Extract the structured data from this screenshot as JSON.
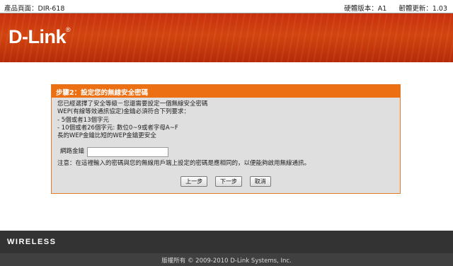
{
  "topbar": {
    "product_page": "產品頁面：DIR-618",
    "hardware_version": "硬體版本：A1",
    "firmware_version": "韌體更新：1.03"
  },
  "header": {
    "logo": "D-Link"
  },
  "wizard": {
    "title": "步驟2：設定您的無線安全密碼",
    "lines": [
      "您已經選擇了安全等級－您還需要設定一個無線安全密碼",
      "WEP(有線等效通訊協定)金鑰必須符合下列要求：",
      "- 5個或者13個字元",
      "- 10個或者26個字元: 數位0~9或者字母A~F",
      "長的WEP金鑰比短的WEP金鑰更安全"
    ],
    "key_label": "網路金鑰",
    "key_value": "",
    "note": "注意：在這裡輸入的密碼與您的無線用戶端上設定的密碼是應相同的，以便能夠啟用無線通訊。",
    "buttons": {
      "prev": "上一步",
      "next": "下一步",
      "cancel": "取消"
    }
  },
  "footer": {
    "brand": "WIRELESS",
    "copyright": "版權所有 © 2009-2010 D-Link Systems, Inc."
  },
  "colors": {
    "header_red": "#c8300e",
    "panel_orange": "#ec6f12",
    "panel_bg": "#dfdfdf",
    "footer_dark": "#333333"
  }
}
